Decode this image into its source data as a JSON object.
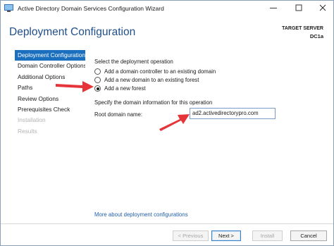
{
  "window": {
    "title": "Active Directory Domain Services Configuration Wizard",
    "app_icon": "ad-ds-icon",
    "controls": [
      "minimize-icon",
      "maximize-icon",
      "close-icon"
    ]
  },
  "header": {
    "title": "Deployment Configuration",
    "target_label": "TARGET SERVER",
    "target_name": "DC1a"
  },
  "nav": {
    "items": [
      {
        "label": "Deployment Configuration",
        "state": "active"
      },
      {
        "label": "Domain Controller Options",
        "state": "normal"
      },
      {
        "label": "Additional Options",
        "state": "normal"
      },
      {
        "label": "Paths",
        "state": "normal"
      },
      {
        "label": "Review Options",
        "state": "normal"
      },
      {
        "label": "Prerequisites Check",
        "state": "normal"
      },
      {
        "label": "Installation",
        "state": "disabled"
      },
      {
        "label": "Results",
        "state": "disabled"
      }
    ]
  },
  "main": {
    "operation_heading": "Select the deployment operation",
    "options": [
      {
        "label": "Add a domain controller to an existing domain",
        "checked": false
      },
      {
        "label": "Add a new domain to an existing forest",
        "checked": false
      },
      {
        "label": "Add a new forest",
        "checked": true
      }
    ],
    "domain_heading": "Specify the domain information for this operation",
    "root_domain_label": "Root domain name:",
    "root_domain_value": "ad2.activedirectorypro.com",
    "more_link": "More about deployment configurations"
  },
  "footer": {
    "previous_label": "< Previous",
    "next_label": "Next >",
    "install_label": "Install",
    "cancel_label": "Cancel"
  },
  "colors": {
    "accent": "#1a6fbf",
    "header_title": "#1f4e8a",
    "annotation_arrow": "#e5353a"
  }
}
